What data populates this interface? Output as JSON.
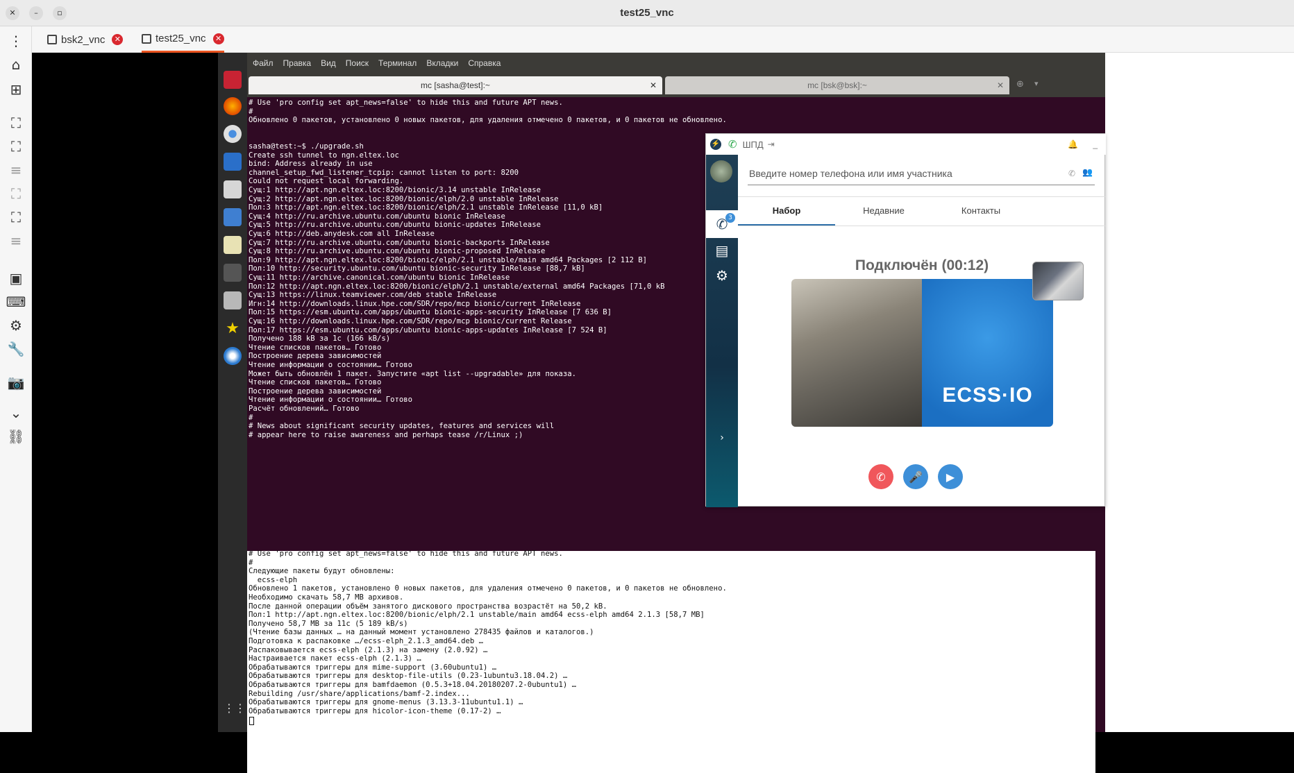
{
  "window": {
    "title": "test25_vnc"
  },
  "viewer_tabs": [
    {
      "label": "bsk2_vnc"
    },
    {
      "label": "test25_vnc"
    }
  ],
  "terminal": {
    "menu": [
      "Файл",
      "Правка",
      "Вид",
      "Поиск",
      "Терминал",
      "Вкладки",
      "Справка"
    ],
    "tabs": [
      {
        "title": "mc [sasha@test]:~"
      },
      {
        "title": "mc [bsk@bsk]:~"
      }
    ],
    "lines_top": [
      "# Use 'pro config set apt_news=false' to hide this and future APT news.",
      "#",
      "Обновлено 0 пакетов, установлено 0 новых пакетов, для удаления отмечено 0 пакетов, и 0 пакетов не обновлено.",
      "",
      "",
      "sasha@test:~$ ./upgrade.sh",
      "Create ssh tunnel to ngn.eltex.loc",
      "bind: Address already in use",
      "channel_setup_fwd_listener_tcpip: cannot listen to port: 8200",
      "Could not request local forwarding.",
      "Сущ:1 http://apt.ngn.eltex.loc:8200/bionic/3.14 unstable InRelease",
      "Сущ:2 http://apt.ngn.eltex.loc:8200/bionic/elph/2.0 unstable InRelease",
      "Пол:3 http://apt.ngn.eltex.loc:8200/bionic/elph/2.1 unstable InRelease [11,0 kB]",
      "Сущ:4 http://ru.archive.ubuntu.com/ubuntu bionic InRelease",
      "Сущ:5 http://ru.archive.ubuntu.com/ubuntu bionic-updates InRelease",
      "Сущ:6 http://deb.anydesk.com all InRelease",
      "Сущ:7 http://ru.archive.ubuntu.com/ubuntu bionic-backports InRelease",
      "Сущ:8 http://ru.archive.ubuntu.com/ubuntu bionic-proposed InRelease",
      "Пол:9 http://apt.ngn.eltex.loc:8200/bionic/elph/2.1 unstable/main amd64 Packages [2 112 B]",
      "Пол:10 http://security.ubuntu.com/ubuntu bionic-security InRelease [88,7 kB]",
      "Сущ:11 http://archive.canonical.com/ubuntu bionic InRelease",
      "Пол:12 http://apt.ngn.eltex.loc:8200/bionic/elph/2.1 unstable/external amd64 Packages [71,0 kB",
      "Сущ:13 https://linux.teamviewer.com/deb stable InRelease",
      "Игн:14 http://downloads.linux.hpe.com/SDR/repo/mcp bionic/current InRelease",
      "Пол:15 https://esm.ubuntu.com/apps/ubuntu bionic-apps-security InRelease [7 636 B]",
      "Сущ:16 http://downloads.linux.hpe.com/SDR/repo/mcp bionic/current Release",
      "Пол:17 https://esm.ubuntu.com/apps/ubuntu bionic-apps-updates InRelease [7 524 B]",
      "Получено 188 kB за 1с (166 kB/s)",
      "Чтение списков пакетов… Готово",
      "Построение дерева зависимостей",
      "Чтение информации о состоянии… Готово",
      "Может быть обновлён 1 пакет. Запустите «apt list --upgradable» для показа.",
      "Чтение списков пакетов… Готово",
      "Построение дерева зависимостей",
      "Чтение информации о состоянии… Готово",
      "Расчёт обновлений… Готово",
      "#",
      "# News about significant security updates, features and services will",
      "# appear here to raise awareness and perhaps tease /r/Linux ;)"
    ],
    "lines_bottom": [
      "# Use 'pro config set apt_news=false' to hide this and future APT news.",
      "#",
      "Следующие пакеты будут обновлены:",
      "  ecss-elph",
      "Обновлено 1 пакетов, установлено 0 новых пакетов, для удаления отмечено 0 пакетов, и 0 пакетов не обновлено.",
      "Необходимо скачать 58,7 MB архивов.",
      "После данной операции объём занятого дискового пространства возрастёт на 50,2 kB.",
      "Пол:1 http://apt.ngn.eltex.loc:8200/bionic/elph/2.1 unstable/main amd64 ecss-elph amd64 2.1.3 [58,7 MB]",
      "Получено 58,7 MB за 11с (5 189 kB/s)",
      "(Чтение базы данных … на данный момент установлено 278435 файлов и каталогов.)",
      "Подготовка к распаковке …/ecss-elph_2.1.3_amd64.deb …",
      "Распаковывается ecss-elph (2.1.3) на замену (2.0.92) …",
      "Настраивается пакет ecss-elph (2.1.3) …",
      "Обрабатываются триггеры для mime-support (3.60ubuntu1) …",
      "Обрабатываются триггеры для desktop-file-utils (0.23-1ubuntu3.18.04.2) …",
      "Обрабатываются триггеры для bamfdaemon (0.5.3+18.04.20180207.2-0ubuntu1) …",
      "Rebuilding /usr/share/applications/bamf-2.index...",
      "Обрабатываются триггеры для gnome-menus (3.13.3-11ubuntu1.1) …",
      "Обрабатываются триггеры для hicolor-icon-theme (0.17-2) …"
    ]
  },
  "phone": {
    "header_label": "ШПД",
    "search_placeholder": "Введите номер телефона или имя участника",
    "tabs": [
      "Набор",
      "Недавние",
      "Контакты"
    ],
    "status": "Подключён  (00:12)",
    "calls_badge": "3",
    "video_logo": "ECSS·IO"
  },
  "colors": {
    "terminal_bg": "#300a24",
    "accent": "#e95420",
    "hangup": "#f0575b",
    "call_btn": "#3d8fd8"
  }
}
